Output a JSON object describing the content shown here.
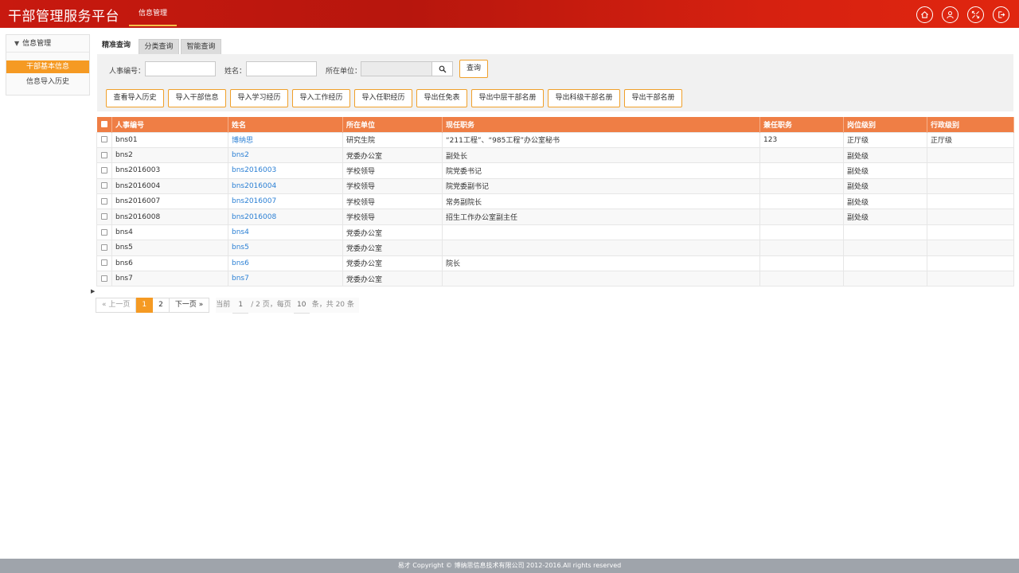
{
  "header": {
    "title": "干部管理服务平台",
    "nav_tab": "信息管理",
    "icons": [
      "home-icon",
      "user-icon",
      "fullscreen-icon",
      "logout-icon"
    ]
  },
  "sidebar": {
    "group": "信息管理",
    "items": [
      {
        "label": "干部基本信息",
        "active": true
      },
      {
        "label": "信息导入历史",
        "active": false
      }
    ]
  },
  "tabs": [
    "精准查询",
    "分类查询",
    "智能查询"
  ],
  "search": {
    "staff_no_label": "人事编号：",
    "name_label": "姓名：",
    "unit_label": "所在单位：",
    "staff_no_value": "",
    "name_value": "",
    "unit_value": "",
    "query_button": "查询"
  },
  "actions": [
    "查看导入历史",
    "导入干部信息",
    "导入学习经历",
    "导入工作经历",
    "导入任职经历",
    "导出任免表",
    "导出中层干部名册",
    "导出科级干部名册",
    "导出干部名册"
  ],
  "table": {
    "columns": [
      "人事编号",
      "姓名",
      "所在单位",
      "现任职务",
      "兼任职务",
      "岗位级别",
      "行政级别"
    ],
    "rows": [
      [
        "bns01",
        "博纳思",
        "研究生院",
        "“211工程”、“985工程”办公室秘书",
        "123",
        "正厅级",
        "正厅级"
      ],
      [
        "bns2",
        "bns2",
        "党委办公室",
        "副处长",
        "",
        "副处级",
        ""
      ],
      [
        "bns2016003",
        "bns2016003",
        "学校领导",
        "院党委书记",
        "",
        "副处级",
        ""
      ],
      [
        "bns2016004",
        "bns2016004",
        "学校领导",
        "院党委副书记",
        "",
        "副处级",
        ""
      ],
      [
        "bns2016007",
        "bns2016007",
        "学校领导",
        "常务副院长",
        "",
        "副处级",
        ""
      ],
      [
        "bns2016008",
        "bns2016008",
        "学校领导",
        "招生工作办公室副主任",
        "",
        "副处级",
        ""
      ],
      [
        "bns4",
        "bns4",
        "党委办公室",
        "",
        "",
        "",
        ""
      ],
      [
        "bns5",
        "bns5",
        "党委办公室",
        "",
        "",
        "",
        ""
      ],
      [
        "bns6",
        "bns6",
        "党委办公室",
        "院长",
        "",
        "",
        ""
      ],
      [
        "bns7",
        "bns7",
        "党委办公室",
        "",
        "",
        "",
        ""
      ]
    ]
  },
  "pager": {
    "prev": "« 上一页",
    "pages": [
      "1",
      "2"
    ],
    "current": "1",
    "next": "下一页 »",
    "info_prefix": "当前",
    "current_page": "1",
    "info_mid": "/ 2 页，每页",
    "per_page": "10",
    "info_suffix": "条，共 20 条"
  },
  "footer": {
    "copyright": "易才 Copyright © 博纳思信息技术有限公司 2012-2016.All rights reserved"
  },
  "colors": {
    "header_red": "#c8190f",
    "accent_orange": "#f59a23",
    "table_header": "#ef7e45",
    "link_blue": "#2a7fd4"
  }
}
